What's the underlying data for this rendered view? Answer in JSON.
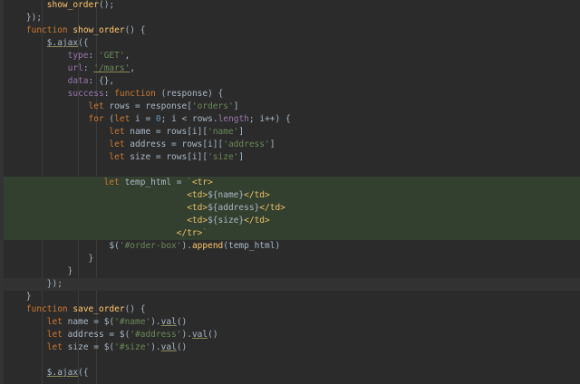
{
  "editor": {
    "colors": {
      "background": "#2b2b2b",
      "keyword": "#cc7832",
      "function": "#ffc66d",
      "string": "#6a8759",
      "number": "#6897bb",
      "property": "#9876aa",
      "text": "#a9b7c6",
      "tag": "#e8bf6a",
      "highlight": "#34402f",
      "current_line": "#323232"
    },
    "highlight_lines": [
      14,
      15,
      16,
      17,
      18
    ],
    "current_line": 22,
    "lines": [
      [
        {
          "t": "        "
        },
        {
          "t": "show_order",
          "c": "fn"
        },
        {
          "t": "();"
        }
      ],
      [
        {
          "t": "    });"
        }
      ],
      [
        {
          "t": "    "
        },
        {
          "t": "function ",
          "c": "kw"
        },
        {
          "t": "show_order",
          "c": "fn"
        },
        {
          "t": "() {"
        }
      ],
      [
        {
          "t": "        "
        },
        {
          "t": "$.ajax",
          "u": 1
        },
        {
          "t": "({"
        }
      ],
      [
        {
          "t": "            "
        },
        {
          "t": "type",
          "c": "prop"
        },
        {
          "t": ": "
        },
        {
          "t": "'GET'",
          "c": "str"
        },
        {
          "t": ","
        }
      ],
      [
        {
          "t": "            "
        },
        {
          "t": "url",
          "c": "prop"
        },
        {
          "t": ": "
        },
        {
          "t": "'/mars'",
          "c": "str",
          "u": 1
        },
        {
          "t": ","
        }
      ],
      [
        {
          "t": "            "
        },
        {
          "t": "data",
          "c": "prop"
        },
        {
          "t": ": {},"
        }
      ],
      [
        {
          "t": "            "
        },
        {
          "t": "success",
          "c": "prop"
        },
        {
          "t": ": "
        },
        {
          "t": "function ",
          "c": "kw"
        },
        {
          "t": "(response) {"
        }
      ],
      [
        {
          "t": "                "
        },
        {
          "t": "let ",
          "c": "kw"
        },
        {
          "t": "rows = response["
        },
        {
          "t": "'orders'",
          "c": "str"
        },
        {
          "t": "]"
        }
      ],
      [
        {
          "t": "                "
        },
        {
          "t": "for ",
          "c": "kw"
        },
        {
          "t": "("
        },
        {
          "t": "let ",
          "c": "kw"
        },
        {
          "t": "i = "
        },
        {
          "t": "0",
          "c": "num"
        },
        {
          "t": "; i < rows."
        },
        {
          "t": "length",
          "c": "prop"
        },
        {
          "t": "; i++) {"
        }
      ],
      [
        {
          "t": "                    "
        },
        {
          "t": "let ",
          "c": "kw"
        },
        {
          "t": "name = rows[i]["
        },
        {
          "t": "'name'",
          "c": "str"
        },
        {
          "t": "]"
        }
      ],
      [
        {
          "t": "                    "
        },
        {
          "t": "let ",
          "c": "kw"
        },
        {
          "t": "address = rows[i]["
        },
        {
          "t": "'address'",
          "c": "str"
        },
        {
          "t": "]"
        }
      ],
      [
        {
          "t": "                    "
        },
        {
          "t": "let ",
          "c": "kw"
        },
        {
          "t": "size = rows[i]["
        },
        {
          "t": "'size'",
          "c": "str"
        },
        {
          "t": "]"
        }
      ],
      [],
      [
        {
          "t": "                   "
        },
        {
          "t": "let ",
          "c": "kw"
        },
        {
          "t": "temp_html = "
        },
        {
          "t": "`",
          "c": "str"
        },
        {
          "t": "<tr>",
          "c": "tag"
        }
      ],
      [
        {
          "t": "                                   "
        },
        {
          "t": "<td>",
          "c": "tag"
        },
        {
          "t": "${name}",
          "c": "tpl"
        },
        {
          "t": "</td>",
          "c": "tag"
        }
      ],
      [
        {
          "t": "                                   "
        },
        {
          "t": "<td>",
          "c": "tag"
        },
        {
          "t": "${address}",
          "c": "tpl"
        },
        {
          "t": "</td>",
          "c": "tag"
        }
      ],
      [
        {
          "t": "                                   "
        },
        {
          "t": "<td>",
          "c": "tag"
        },
        {
          "t": "${size}",
          "c": "tpl"
        },
        {
          "t": "</td>",
          "c": "tag"
        }
      ],
      [
        {
          "t": "                                 "
        },
        {
          "t": "</tr>",
          "c": "tag"
        },
        {
          "t": "`",
          "c": "str"
        }
      ],
      [
        {
          "t": "                    $("
        },
        {
          "t": "'#order-box'",
          "c": "str"
        },
        {
          "t": ")."
        },
        {
          "t": "append",
          "c": "fn"
        },
        {
          "t": "(temp_html)"
        }
      ],
      [
        {
          "t": "                }"
        }
      ],
      [
        {
          "t": "            }"
        }
      ],
      [
        {
          "t": "        });"
        }
      ],
      [
        {
          "t": "    }"
        }
      ],
      [
        {
          "t": "    "
        },
        {
          "t": "function ",
          "c": "kw"
        },
        {
          "t": "save_order",
          "c": "fn"
        },
        {
          "t": "() {"
        }
      ],
      [
        {
          "t": "        "
        },
        {
          "t": "let ",
          "c": "kw"
        },
        {
          "t": "name = $("
        },
        {
          "t": "'#name'",
          "c": "str"
        },
        {
          "t": ")."
        },
        {
          "t": "val",
          "u": 1
        },
        {
          "t": "()"
        }
      ],
      [
        {
          "t": "        "
        },
        {
          "t": "let ",
          "c": "kw"
        },
        {
          "t": "address = $("
        },
        {
          "t": "'#address'",
          "c": "str"
        },
        {
          "t": ")."
        },
        {
          "t": "val",
          "u": 1
        },
        {
          "t": "()"
        }
      ],
      [
        {
          "t": "        "
        },
        {
          "t": "let ",
          "c": "kw"
        },
        {
          "t": "size = $("
        },
        {
          "t": "'#size'",
          "c": "str"
        },
        {
          "t": ")."
        },
        {
          "t": "val",
          "u": 1
        },
        {
          "t": "()"
        }
      ],
      [],
      [
        {
          "t": "        "
        },
        {
          "t": "$.ajax",
          "u": 1
        },
        {
          "t": "({"
        }
      ]
    ]
  }
}
